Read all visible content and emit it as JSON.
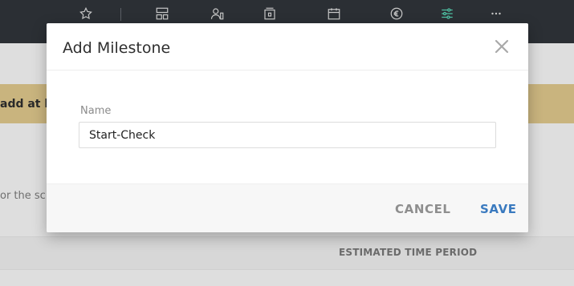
{
  "topbar": {
    "icons": [
      {
        "name": "star-icon",
        "glyph": "☆"
      },
      {
        "name": "layout-icon",
        "glyph": "▤"
      },
      {
        "name": "people-icon",
        "glyph": "👤"
      },
      {
        "name": "archive-icon",
        "glyph": "▣"
      },
      {
        "name": "calendar-icon",
        "glyph": "📅"
      },
      {
        "name": "euro-icon",
        "glyph": "€"
      },
      {
        "name": "sliders-icon",
        "glyph": "≡"
      },
      {
        "name": "more-icon",
        "glyph": "⋯"
      }
    ],
    "active_color": "#4fc0a3"
  },
  "background": {
    "warning_text": "add at le",
    "schedule_text": "or the sch",
    "table_column": "ESTIMATED TIME PERIOD"
  },
  "modal": {
    "title": "Add Milestone",
    "close_icon": "close-icon",
    "field": {
      "label": "Name",
      "value": "Start-Check"
    },
    "cancel_label": "CANCEL",
    "save_label": "SAVE"
  },
  "colors": {
    "primary": "#3a7abf",
    "cancel": "#8e8e8e",
    "warning": "#c9b47e",
    "topbar": "#2b2f34"
  }
}
